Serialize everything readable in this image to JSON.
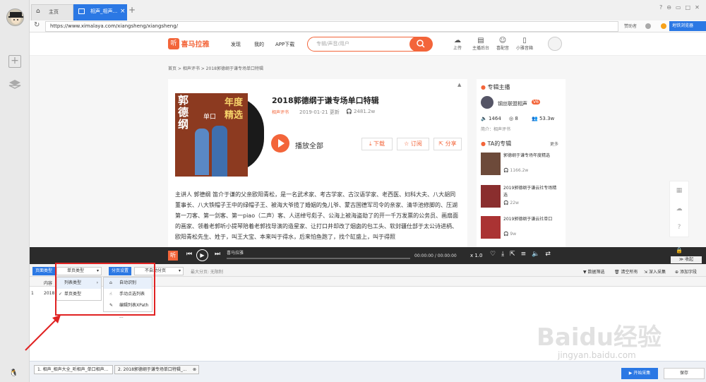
{
  "browser": {
    "tabs": [
      {
        "label": "主页"
      },
      {
        "label": "相声_相声..."
      }
    ],
    "url": "https://www.ximalaya.com/xiangsheng/xiangsheng/",
    "right_links": [
      "赞助者",
      "地铁浏览器"
    ]
  },
  "site": {
    "logo_text": "喜马拉雅",
    "nav": [
      "发现",
      "我的",
      "APP下载"
    ],
    "search_placeholder": "专辑/声音/用户",
    "top_icons": [
      "上传",
      "主播后台",
      "喜配音",
      "小雅音箱"
    ]
  },
  "breadcrumb": "首页 > 相声评书 > 2018郭德纲于谦专场单口特辑",
  "album": {
    "cover_text": [
      "郭德纲",
      "年度",
      "精选",
      "单口"
    ],
    "title": "2018郭德纲于谦专场单口特辑",
    "tag": "相声评书",
    "date": "2019-01-21 更新",
    "plays": "2481.2w",
    "play_all": "播放全部",
    "buttons": [
      "下载",
      "订阅",
      "分享"
    ],
    "description": "主讲人 郭德纲 笛介于谦的父亲欧阳青松，是一名武术家、考古学家、古汉语学家、老西医、妇科大夫、八大胡同董事长、八大铁帽子王中的绿帽子王、被海大爷揽了婚姻的兔儿爷、蒙古国德军司令的亲家、清华池修脚的、压湖第一刀客、第一剑客、第一piao（二声）客、人送绰号彪子、公海上被海盗劫了的开一千万发票的公务员、画扇面的画家、领着老郭听小提琴陪着老郭找导演的造星家、让打口井却改了烟囱的包工头、软封疆仕部于太公诗进柄、欧阳青松先生、姓于，叫王大宝、本来叫于得水，后来怕鱼跑了，找个缸盛上，叫于得照"
  },
  "sidebar": {
    "host_title": "专辑主播",
    "host_name": "钢丝联盟相声",
    "host_badge": "V6",
    "stats": [
      "1464",
      "8",
      "53.3w"
    ],
    "intro": "简介：相声评书",
    "ta_title": "TA的专辑",
    "more": "更多",
    "albums": [
      {
        "title": "郭德纲于谦专场年度精选",
        "plays": "1166.2w"
      },
      {
        "title": "2019郭德纲于谦云社专场精选",
        "plays": "22w"
      },
      {
        "title": "2019郭德纲于谦云社单口",
        "plays": "9w"
      }
    ]
  },
  "player": {
    "logo": "听",
    "track": "喜马拉雅",
    "time": "00:00:00 / 00:00:00",
    "speed": "x 1.0",
    "collapse": "收起"
  },
  "collector": {
    "page_type_label": "页面类型",
    "page_type_value": "单页类型",
    "pagination_label": "分页设置",
    "pagination_value": "不自动分页",
    "max_pages": "最大分页: 无限制",
    "right_actions": [
      "数据筛选",
      "清空所有",
      "深入采集",
      "添加字段"
    ],
    "menu1": [
      "列表类型",
      "单页类型"
    ],
    "menu2": [
      "自动识别",
      "手动点选列表",
      "编辑列表XPath ..."
    ],
    "grid_header": "内容",
    "row_num": "1",
    "row_value": "2018"
  },
  "bottom": {
    "tabs": [
      "1. 相声_相声大全_听相声_单口相声...",
      "2. 2018郭德纲于谦专场单口特辑_..."
    ],
    "start_btn": "开始采集",
    "save_btn": "保存"
  },
  "watermark": {
    "brand": "Baidu经验",
    "url": "jingyan.baidu.com"
  },
  "colors": {
    "accent": "#f3653a",
    "blue": "#2b78e4",
    "annotation": "#e02222"
  }
}
